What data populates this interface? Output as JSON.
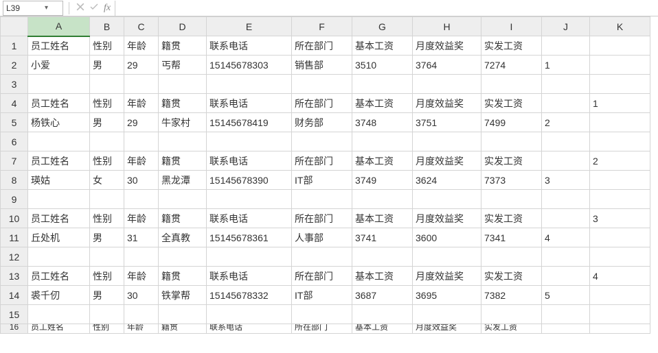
{
  "name_box": {
    "value": "L39"
  },
  "formula_bar": {
    "cancel_tip": "×",
    "enter_tip": "✓",
    "fx_label": "fx",
    "value": ""
  },
  "columns": [
    "A",
    "B",
    "C",
    "D",
    "E",
    "F",
    "G",
    "H",
    "I",
    "J",
    "K"
  ],
  "selected_column_index": 0,
  "row_labels": [
    "1",
    "2",
    "3",
    "4",
    "5",
    "6",
    "7",
    "8",
    "9",
    "10",
    "11",
    "12",
    "13",
    "14",
    "15",
    "16"
  ],
  "headers": {
    "name": "员工姓名",
    "gender": "性别",
    "age": "年龄",
    "origin": "籍贯",
    "phone": "联系电话",
    "dept": "所在部门",
    "base": "基本工资",
    "bonus": "月度效益奖",
    "actual": "实发工资"
  },
  "cells": {
    "r1": [
      "员工姓名",
      "性别",
      "年龄",
      "籍贯",
      "联系电话",
      "所在部门",
      "基本工资",
      "月度效益奖",
      "实发工资",
      "",
      ""
    ],
    "r2": [
      "小爱",
      "男",
      "29",
      "丐帮",
      "15145678303",
      "销售部",
      "3510",
      "3764",
      "7274",
      "1",
      ""
    ],
    "r3": [
      "",
      "",
      "",
      "",
      "",
      "",
      "",
      "",
      "",
      "",
      ""
    ],
    "r4": [
      "员工姓名",
      "性别",
      "年龄",
      "籍贯",
      "联系电话",
      "所在部门",
      "基本工资",
      "月度效益奖",
      "实发工资",
      "",
      "1"
    ],
    "r5": [
      "杨铁心",
      "男",
      "29",
      "牛家村",
      "15145678419",
      "财务部",
      "3748",
      "3751",
      "7499",
      "2",
      ""
    ],
    "r6": [
      "",
      "",
      "",
      "",
      "",
      "",
      "",
      "",
      "",
      "",
      ""
    ],
    "r7": [
      "员工姓名",
      "性别",
      "年龄",
      "籍贯",
      "联系电话",
      "所在部门",
      "基本工资",
      "月度效益奖",
      "实发工资",
      "",
      "2"
    ],
    "r8": [
      "瑛姑",
      "女",
      "30",
      "黑龙潭",
      "15145678390",
      "IT部",
      "3749",
      "3624",
      "7373",
      "3",
      ""
    ],
    "r9": [
      "",
      "",
      "",
      "",
      "",
      "",
      "",
      "",
      "",
      "",
      ""
    ],
    "r10": [
      "员工姓名",
      "性别",
      "年龄",
      "籍贯",
      "联系电话",
      "所在部门",
      "基本工资",
      "月度效益奖",
      "实发工资",
      "",
      "3"
    ],
    "r11": [
      "丘处机",
      "男",
      "31",
      "全真教",
      "15145678361",
      "人事部",
      "3741",
      "3600",
      "7341",
      "4",
      ""
    ],
    "r12": [
      "",
      "",
      "",
      "",
      "",
      "",
      "",
      "",
      "",
      "",
      ""
    ],
    "r13": [
      "员工姓名",
      "性别",
      "年龄",
      "籍贯",
      "联系电话",
      "所在部门",
      "基本工资",
      "月度效益奖",
      "实发工资",
      "",
      "4"
    ],
    "r14": [
      "裘千仞",
      "男",
      "30",
      "铁掌帮",
      "15145678332",
      "IT部",
      "3687",
      "3695",
      "7382",
      "5",
      ""
    ],
    "r15": [
      "",
      "",
      "",
      "",
      "",
      "",
      "",
      "",
      "",
      "",
      ""
    ],
    "r16": [
      "员工姓名",
      "性别",
      "年龄",
      "籍贯",
      "联系电话",
      "所在部门",
      "基本工资",
      "月度效益奖",
      "实发工资",
      "",
      ""
    ]
  },
  "chart_data": {
    "type": "table",
    "columns": [
      "员工姓名",
      "性别",
      "年龄",
      "籍贯",
      "联系电话",
      "所在部门",
      "基本工资",
      "月度效益奖",
      "实发工资"
    ],
    "records": [
      {
        "员工姓名": "小爱",
        "性别": "男",
        "年龄": 29,
        "籍贯": "丐帮",
        "联系电话": "15145678303",
        "所在部门": "销售部",
        "基本工资": 3510,
        "月度效益奖": 3764,
        "实发工资": 7274,
        "J": 1
      },
      {
        "员工姓名": "杨铁心",
        "性别": "男",
        "年龄": 29,
        "籍贯": "牛家村",
        "联系电话": "15145678419",
        "所在部门": "财务部",
        "基本工资": 3748,
        "月度效益奖": 3751,
        "实发工资": 7499,
        "J": 2,
        "K": 1
      },
      {
        "员工姓名": "瑛姑",
        "性别": "女",
        "年龄": 30,
        "籍贯": "黑龙潭",
        "联系电话": "15145678390",
        "所在部门": "IT部",
        "基本工资": 3749,
        "月度效益奖": 3624,
        "实发工资": 7373,
        "J": 3,
        "K": 2
      },
      {
        "员工姓名": "丘处机",
        "性别": "男",
        "年龄": 31,
        "籍贯": "全真教",
        "联系电话": "15145678361",
        "所在部门": "人事部",
        "基本工资": 3741,
        "月度效益奖": 3600,
        "实发工资": 7341,
        "J": 4,
        "K": 3
      },
      {
        "员工姓名": "裘千仞",
        "性别": "男",
        "年龄": 30,
        "籍贯": "铁掌帮",
        "联系电话": "15145678332",
        "所在部门": "IT部",
        "基本工资": 3687,
        "月度效益奖": 3695,
        "实发工资": 7382,
        "J": 5,
        "K": 4
      }
    ]
  }
}
